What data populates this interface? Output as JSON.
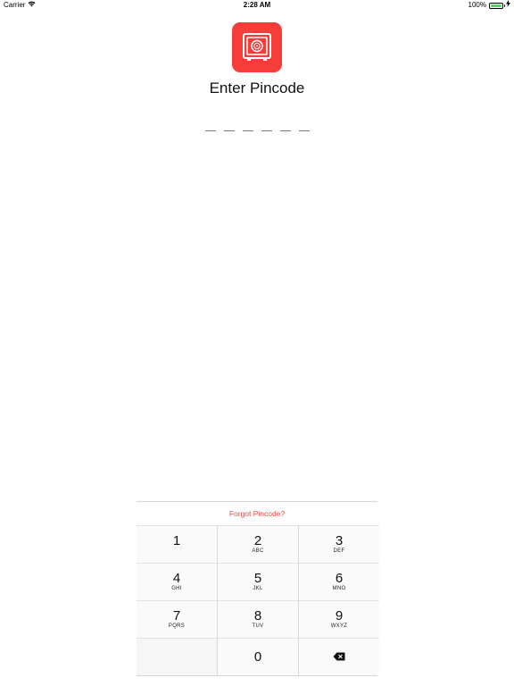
{
  "status_bar": {
    "carrier": "Carrier",
    "wifi_icon": "wifi-icon",
    "time": "2:28 AM",
    "battery_text": "100%",
    "battery_color": "#4cd964",
    "charging_icon": "charging-icon"
  },
  "app_icon": {
    "name": "safe-vault-icon",
    "color": "#f53d3a"
  },
  "title": "Enter Pincode",
  "pin": {
    "length": 6,
    "entered": 0
  },
  "forgot_link": "Forgot Pincode?",
  "accent_color": "#f4413e",
  "keypad": {
    "keys": [
      {
        "num": "1",
        "letters": ""
      },
      {
        "num": "2",
        "letters": "ABC"
      },
      {
        "num": "3",
        "letters": "DEF"
      },
      {
        "num": "4",
        "letters": "GHI"
      },
      {
        "num": "5",
        "letters": "JKL"
      },
      {
        "num": "6",
        "letters": "MNO"
      },
      {
        "num": "7",
        "letters": "PQRS"
      },
      {
        "num": "8",
        "letters": "TUV"
      },
      {
        "num": "9",
        "letters": "WXYZ"
      },
      {
        "num": "0",
        "letters": ""
      }
    ],
    "delete_icon": "delete-backspace-icon"
  }
}
